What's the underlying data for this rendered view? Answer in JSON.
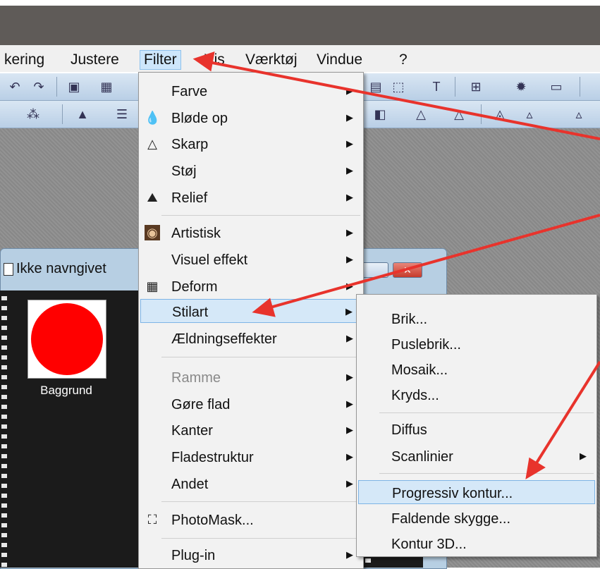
{
  "menubar": {
    "items": [
      {
        "label": "kering"
      },
      {
        "label": "Justere"
      },
      {
        "label": "Filter"
      },
      {
        "label": "Vis"
      },
      {
        "label": "Værktøj"
      },
      {
        "label": "Vindue"
      },
      {
        "label": "?"
      }
    ]
  },
  "document": {
    "title": "Ikke navngivet",
    "layer_label": "Baggrund"
  },
  "filter_menu": {
    "items": [
      {
        "label": "Farve",
        "icon": "none"
      },
      {
        "label": "Bløde op",
        "icon": "drop-icon"
      },
      {
        "label": "Skarp",
        "icon": "triangle-icon"
      },
      {
        "label": "Støj",
        "icon": "none"
      },
      {
        "label": "Relief",
        "icon": "relief-icon"
      },
      {
        "label": "Artistisk",
        "icon": "mona-lisa-icon"
      },
      {
        "label": "Visuel effekt",
        "icon": "none"
      },
      {
        "label": "Deform",
        "icon": "grid-icon"
      },
      {
        "label": "Stilart",
        "icon": "none"
      },
      {
        "label": "Ældningseffekter",
        "icon": "none"
      },
      {
        "label": "Ramme",
        "icon": "none"
      },
      {
        "label": "Gøre flad",
        "icon": "none"
      },
      {
        "label": "Kanter",
        "icon": "none"
      },
      {
        "label": "Fladestruktur",
        "icon": "none"
      },
      {
        "label": "Andet",
        "icon": "none"
      },
      {
        "label": "PhotoMask...",
        "icon": "photomask-icon"
      },
      {
        "label": "Plug-in",
        "icon": "none"
      }
    ]
  },
  "stilart_submenu": {
    "items": [
      {
        "label": "Brik..."
      },
      {
        "label": "Puslebrik..."
      },
      {
        "label": "Mosaik..."
      },
      {
        "label": "Kryds..."
      },
      {
        "label": "Diffus"
      },
      {
        "label": "Scanlinier"
      },
      {
        "label": "Progressiv kontur..."
      },
      {
        "label": "Faldende skygge..."
      },
      {
        "label": "Kontur 3D..."
      }
    ]
  },
  "colors": {
    "annotation_arrow": "#e8332c",
    "highlight": "#d5e8f8",
    "thumbnail_fill": "#ff0000"
  }
}
